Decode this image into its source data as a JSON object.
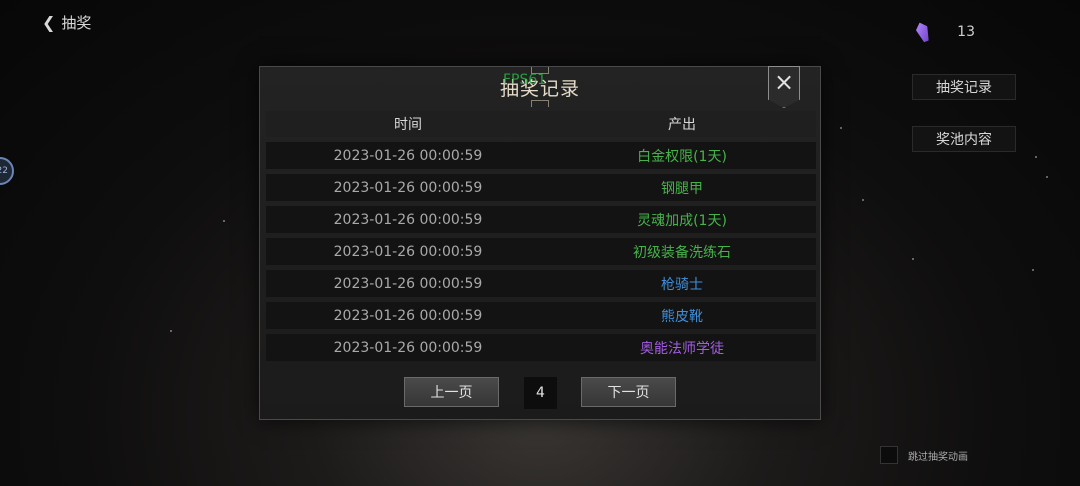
{
  "header": {
    "back_label": "抽奖"
  },
  "currency": {
    "amount": "13",
    "icon": "purple-crystal-icon",
    "color": "#9b6bf0"
  },
  "side_buttons": {
    "records": "抽奖记录",
    "pool": "奖池内容"
  },
  "skip_animation": {
    "label": "跳过抽奖动画"
  },
  "left_badge": {
    "text": "22"
  },
  "dialog": {
    "title": "抽奖记录",
    "fps_overlay": "FPS61",
    "close_icon": "×",
    "columns": {
      "time": "时间",
      "item": "产出"
    },
    "rows": [
      {
        "time": "2023-01-26 00:00:59",
        "item": "白金权限(1天)",
        "color": "#45b34a"
      },
      {
        "time": "2023-01-26 00:00:59",
        "item": "钢腿甲",
        "color": "#45b34a"
      },
      {
        "time": "2023-01-26 00:00:59",
        "item": "灵魂加成(1天)",
        "color": "#45b34a"
      },
      {
        "time": "2023-01-26 00:00:59",
        "item": "初级装备洗练石",
        "color": "#45b34a"
      },
      {
        "time": "2023-01-26 00:00:59",
        "item": "枪骑士",
        "color": "#3f8ed8"
      },
      {
        "time": "2023-01-26 00:00:59",
        "item": "熊皮靴",
        "color": "#3f8ed8"
      },
      {
        "time": "2023-01-26 00:00:59",
        "item": "奥能法师学徒",
        "color": "#a25de0"
      }
    ],
    "pager": {
      "prev_label": "上一页",
      "page": "4",
      "next_label": "下一页"
    }
  }
}
